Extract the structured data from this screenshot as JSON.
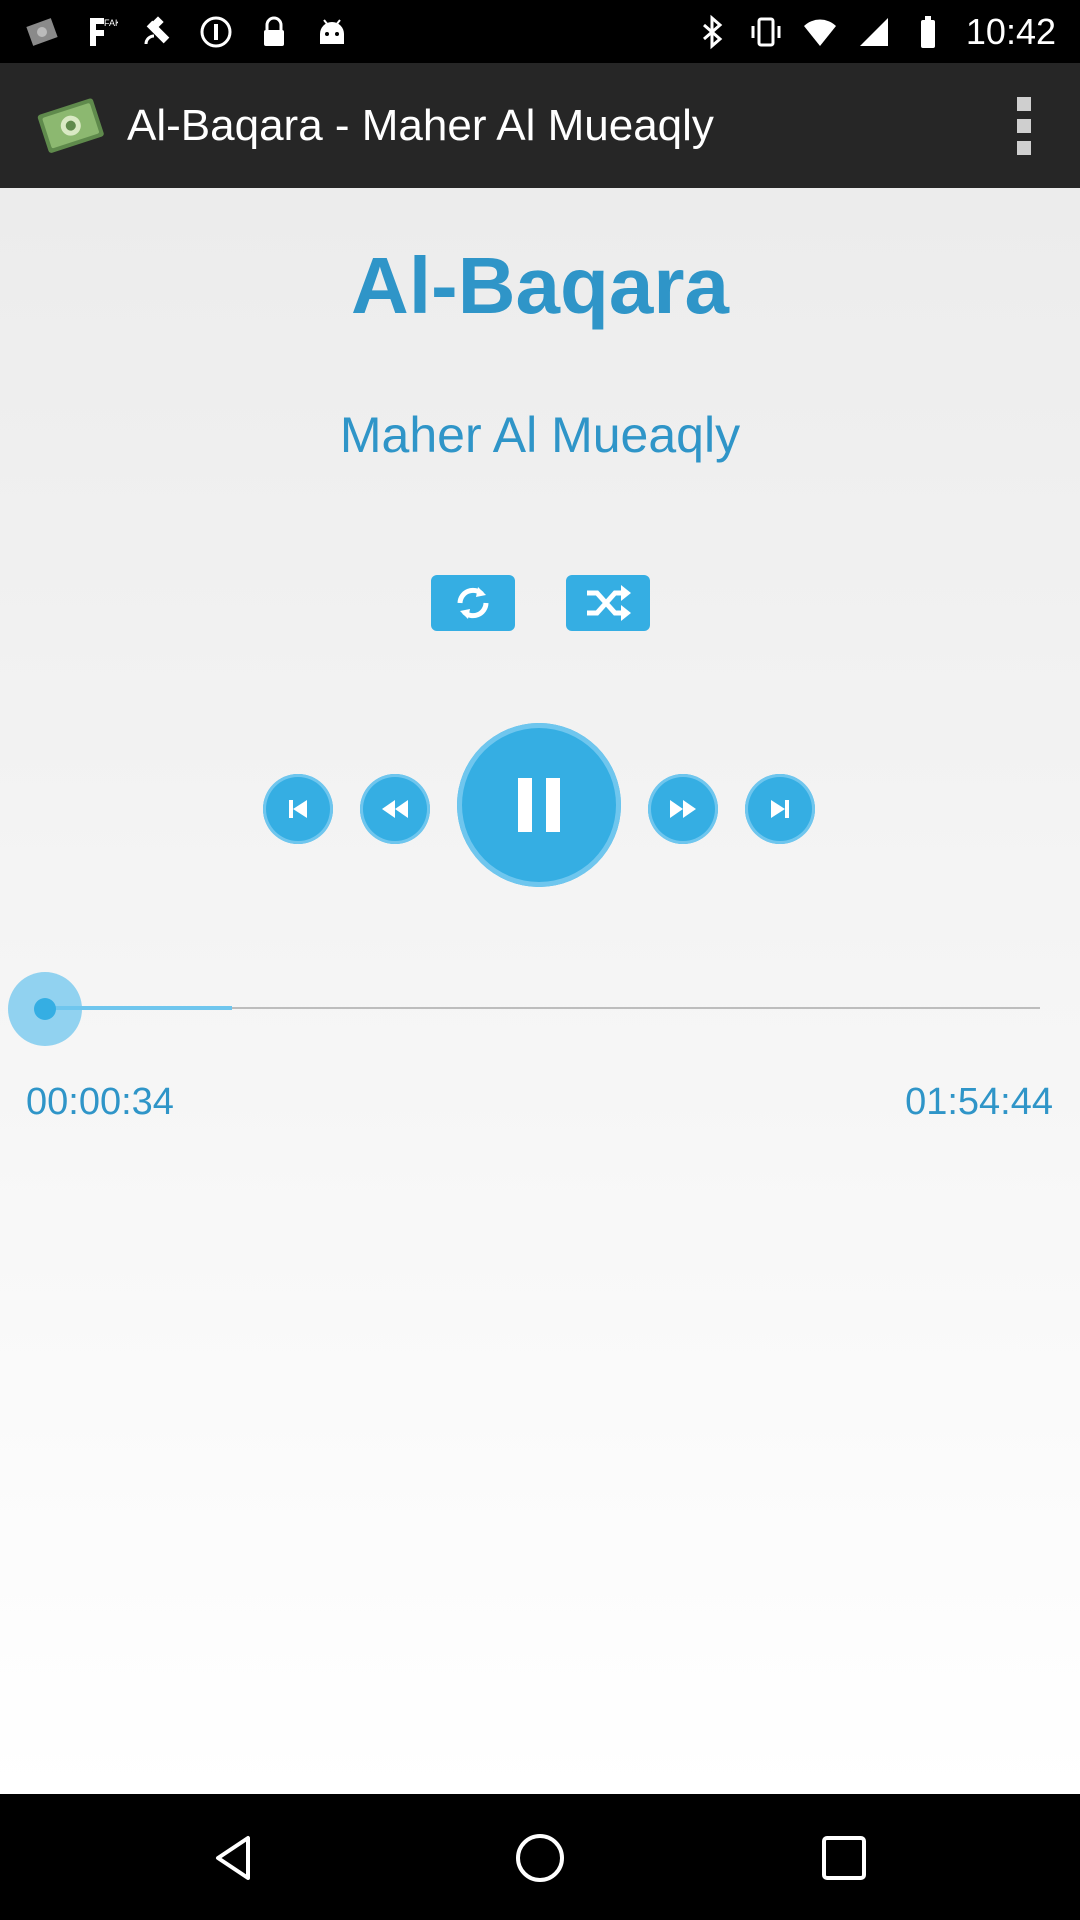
{
  "status_bar": {
    "time": "10:42",
    "left_icons": [
      "quran-app-icon",
      "fake-gps-icon",
      "satellite-icon",
      "info-circle-icon",
      "lock-icon",
      "android-icon"
    ],
    "right_icons": [
      "bluetooth-icon",
      "vibrate-icon",
      "wifi-icon",
      "signal-icon",
      "battery-icon"
    ]
  },
  "action_bar": {
    "title": "Al-Baqara - Maher Al Mueaqly",
    "logo_icon": "quran-book-icon",
    "overflow_icon": "more-vert-icon"
  },
  "player": {
    "surah": "Al-Baqara",
    "reciter": "Maher Al Mueaqly",
    "modes": [
      {
        "name": "repeat",
        "icon": "repeat-icon"
      },
      {
        "name": "shuffle",
        "icon": "shuffle-icon"
      }
    ],
    "controls": [
      {
        "name": "previous",
        "icon": "skip-previous-icon"
      },
      {
        "name": "rewind",
        "icon": "rewind-icon"
      },
      {
        "name": "pause",
        "icon": "pause-icon"
      },
      {
        "name": "fast-forward",
        "icon": "fast-forward-icon"
      },
      {
        "name": "next",
        "icon": "skip-next-icon"
      }
    ],
    "elapsed": "00:00:34",
    "total": "01:54:44",
    "progress_fraction": 0.005,
    "accent_color": "#35aee3",
    "text_color": "#2f95c8"
  },
  "nav_bar": {
    "buttons": [
      "back-icon",
      "home-icon",
      "recents-icon"
    ]
  }
}
